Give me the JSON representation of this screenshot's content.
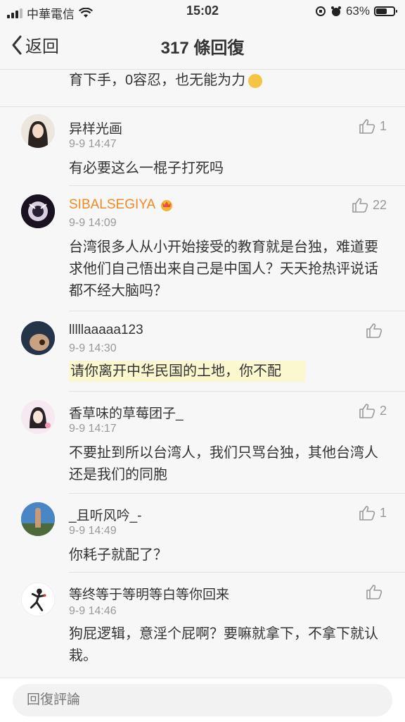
{
  "status_bar": {
    "carrier": "中華電信",
    "time": "15:02",
    "battery": "63%",
    "battery_level": 0.63
  },
  "header": {
    "back_label": "返回",
    "title": "317 條回復"
  },
  "partial_comment": {
    "text": "育下手，0容忍，也无能为力"
  },
  "comments": [
    {
      "username": "异样光画",
      "time": "9-9 14:47",
      "likes": "1",
      "text": "有必要这么一棍子打死吗"
    },
    {
      "username": "SIBALSEGIYA",
      "time": "9-9 14:09",
      "likes": "22",
      "text": "台湾很多人从小开始接受的教育就是台独，难道要求他们自己悟出来自己是中国人？天天抢热评说话都不经大脑吗？"
    },
    {
      "username": "lllllaaaaa123",
      "time": "9-9 14:30",
      "likes": "",
      "text": "请你离开中华民国的土地，你不配"
    },
    {
      "username": "香草味的草莓团子_",
      "time": "9-9 14:17",
      "likes": "2",
      "text": "不要扯到所以台湾人，我们只骂台独，其他台湾人还是我们的同胞"
    },
    {
      "username": "_且听风吟_-",
      "time": "9-9 14:49",
      "likes": "1",
      "text": "你耗子就配了？"
    },
    {
      "username": "等终等于等明等白等你回来",
      "time": "9-9 14:46",
      "likes": "",
      "text": "狗屁逻辑，意淫个屁啊？要嘛就拿下，不拿下就认栽。"
    }
  ],
  "footer": {
    "placeholder": "回復評論"
  },
  "colors": {
    "vip_username": "#f08a24",
    "highlight": "#fbf8d0",
    "muted": "#999999"
  }
}
